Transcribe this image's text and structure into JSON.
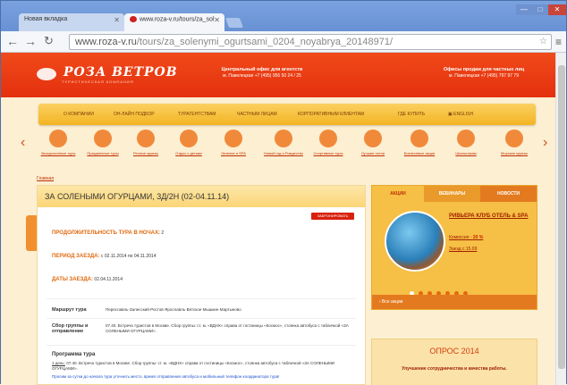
{
  "browser": {
    "tabs": [
      {
        "title": "Новая вкладка",
        "active": false
      },
      {
        "title": "www.roza-v.ru/tours/za_sol",
        "active": true
      }
    ],
    "url_host": "www.roza-v.ru",
    "url_path": "/tours/za_solenymi_ogurtsami_0204_noyabrya_20148971/",
    "window_controls": [
      "—",
      "□",
      "✕"
    ]
  },
  "site": {
    "logo": "РОЗА ВЕТРОВ",
    "logo_sub": "ТУРИСТИЧЕСКАЯ КОМПАНИЯ",
    "office_agents_title": "Центральный офис для агентств",
    "office_agents_info": "м. Павелецкая +7 (495) 956 50 24 / 25",
    "office_private_title": "Офисы продаж для частных лиц",
    "office_private_info": "м. Павелецкая +7 (495) 797 97 79"
  },
  "menu": [
    "О КОМПАНИИ",
    "ОН-ЛАЙН ПОДБОР",
    "ТУРАГЕНТСТВАМ",
    "ЧАСТНЫМ ЛИЦАМ",
    "КОРПОРАТИВНЫМ КЛИЕНТАМ",
    "ГДЕ КУПИТЬ",
    "ENGLISH"
  ],
  "categories": [
    "Экскурсионные туры",
    "Праздничные туры",
    "Речные круизы",
    "Отдых с детьми",
    "Лечение и SPA",
    "Новый год и Рождество",
    "Спортивные туры",
    "Лучшие отели",
    "Бизнесевые акции",
    "Школьникам",
    "Морские круизы"
  ],
  "breadcrumb": "Главная",
  "tour": {
    "title": "ЗА СОЛЕНЫМИ ОГУРЦАМИ, 3Д/2Н (02-04.11.14)",
    "book_label": "ЗАБРОНИРОВАТЬ",
    "nights_label": "ПРОДОЛЖИТЕЛЬНОСТЬ ТУРА В НОЧАХ:",
    "nights_value": "2",
    "period_label": "ПЕРИОД ЗАЕЗДА:",
    "period_value": "с 02.11.2014 по 04.11.2014",
    "dates_label": "ДАТЫ ЗАЕЗДА:",
    "dates_value": "02.04.11.2014",
    "route_label": "Маршрут тура",
    "route_value": "Переславль-Залесский·Ростов·Ярославль·Вятское·Мышкин·Мартыново",
    "meeting_label": "Сбор группы и отправление",
    "meeting_value": "07.40. Встреча туристов в Москве. Сбор группы: ст. м. «ВДНХ» справа от гостиницы «Космос», стоянка автобуса с табличкой «ЗА СОЛЕНЫМИ ОГУРЦАМИ».",
    "program_label": "Программа тура",
    "day1_label": "1 день:",
    "day1_text": "07.40. Встреча туристов в Москве. Сбор группы: ст. м. «ВДНХ» справа от гостиницы «Космос», стоянка автобуса с табличкой «ЗА СОЛЕНЫМИ ОГУРЦАМИ».",
    "note": "Просим за сутки до начала тура уточнить место, время отправления автобуса и мобильный телефон координатора тура!"
  },
  "sidebar": {
    "tabs": [
      "АКЦИИ",
      "ВЕБИНАРЫ",
      "НОВОСТИ"
    ],
    "hotel": "РИВЬЕРА КЛУБ ОТЕЛЬ & SPA",
    "commission_label": "Комиссия -",
    "commission_value": "20 %",
    "departure": "Заезд с 15.09",
    "all_label": "› Все акции",
    "poll_title": "ОПРОС 2014",
    "poll_text": "Улучшение сотрудничества и качества работы."
  },
  "colors": {
    "brand_red": "#e4300e",
    "menu_yellow": "#f3b422",
    "page_bg": "#fcefd2"
  }
}
